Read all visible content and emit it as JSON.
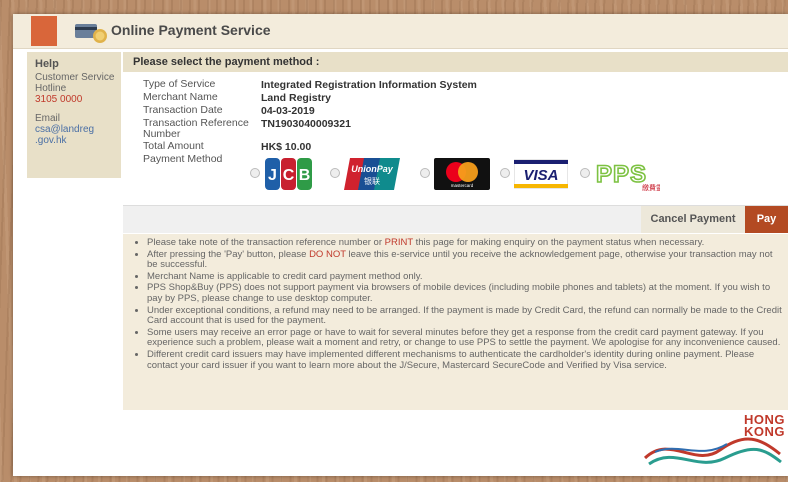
{
  "window": {
    "title": "Online Payment Service"
  },
  "sidebar": {
    "help_label": "Help",
    "hotline_label": "Customer Service Hotline",
    "hotline_number": "3105 0000",
    "email_label": "Email",
    "email_line1": "csa@landreg",
    "email_line2": ".gov.hk"
  },
  "main": {
    "section_heading": "Please select the payment method :",
    "details": [
      {
        "label": "Type of Service",
        "value": "Integrated Registration Information System"
      },
      {
        "label": "Merchant Name",
        "value": "Land Registry"
      },
      {
        "label": "Transaction Date",
        "value": "04-03-2019"
      },
      {
        "label": "Transaction Reference Number",
        "value": "TN1903040009321"
      },
      {
        "label": "Total Amount",
        "value": "HK$ 10.00"
      }
    ],
    "payment_method_label": "Payment Method",
    "payment_methods": [
      {
        "name": "JCB",
        "icon": "jcb-logo",
        "selected": false
      },
      {
        "name": "UnionPay",
        "sub": "银联",
        "icon": "unionpay-logo",
        "selected": false
      },
      {
        "name": "mastercard",
        "icon": "mastercard-logo",
        "selected": false
      },
      {
        "name": "VISA",
        "icon": "visa-logo",
        "selected": false
      },
      {
        "name": "PPS",
        "sub": "繳費靈",
        "icon": "pps-logo",
        "selected": false
      }
    ]
  },
  "actions": {
    "cancel_label": "Cancel Payment",
    "pay_label": "Pay"
  },
  "notes": [
    {
      "pre": "Please take note of the transaction reference number or ",
      "highlight": "PRINT",
      "post": " this page for making enquiry on the payment status when necessary."
    },
    {
      "pre": "After pressing the 'Pay' button, please ",
      "highlight": "DO NOT",
      "post": " leave this e-service until you receive the acknowledgement page, otherwise your transaction may not be successful."
    },
    {
      "pre": "Merchant Name is applicable to credit card payment method only.",
      "highlight": "",
      "post": ""
    },
    {
      "pre": "PPS Shop&Buy (PPS) does not support payment via browsers of mobile devices (including mobile phones and tablets) at the moment. If you wish to pay by PPS, please change to use desktop computer.",
      "highlight": "",
      "post": ""
    },
    {
      "pre": "Under exceptional conditions, a refund may need to be arranged. If the payment is made by Credit Card, the refund can normally be made to the Credit Card account that is used for the payment.",
      "highlight": "",
      "post": ""
    },
    {
      "pre": "Some users may receive an error page or have to wait for several minutes before they get a response from the credit card payment gateway. If you experience such a problem, please wait a moment and retry, or change to use PPS to settle the payment. We apologise for any inconvenience caused.",
      "highlight": "",
      "post": ""
    },
    {
      "pre": "Different credit card issuers may have implemented different mechanisms to authenticate the cardholder's identity during online payment. Please contact your card issuer if you want to learn more about the J/Secure, Mastercard SecureCode and Verified by Visa service.",
      "highlight": "",
      "post": ""
    }
  ],
  "footer": {
    "logo_line1": "HONG",
    "logo_line2": "KONG"
  },
  "colors": {
    "accent": "#b34a22",
    "panel": "#e8e0c8",
    "highlight": "#c0392b",
    "pps_green": "#7dc242"
  }
}
